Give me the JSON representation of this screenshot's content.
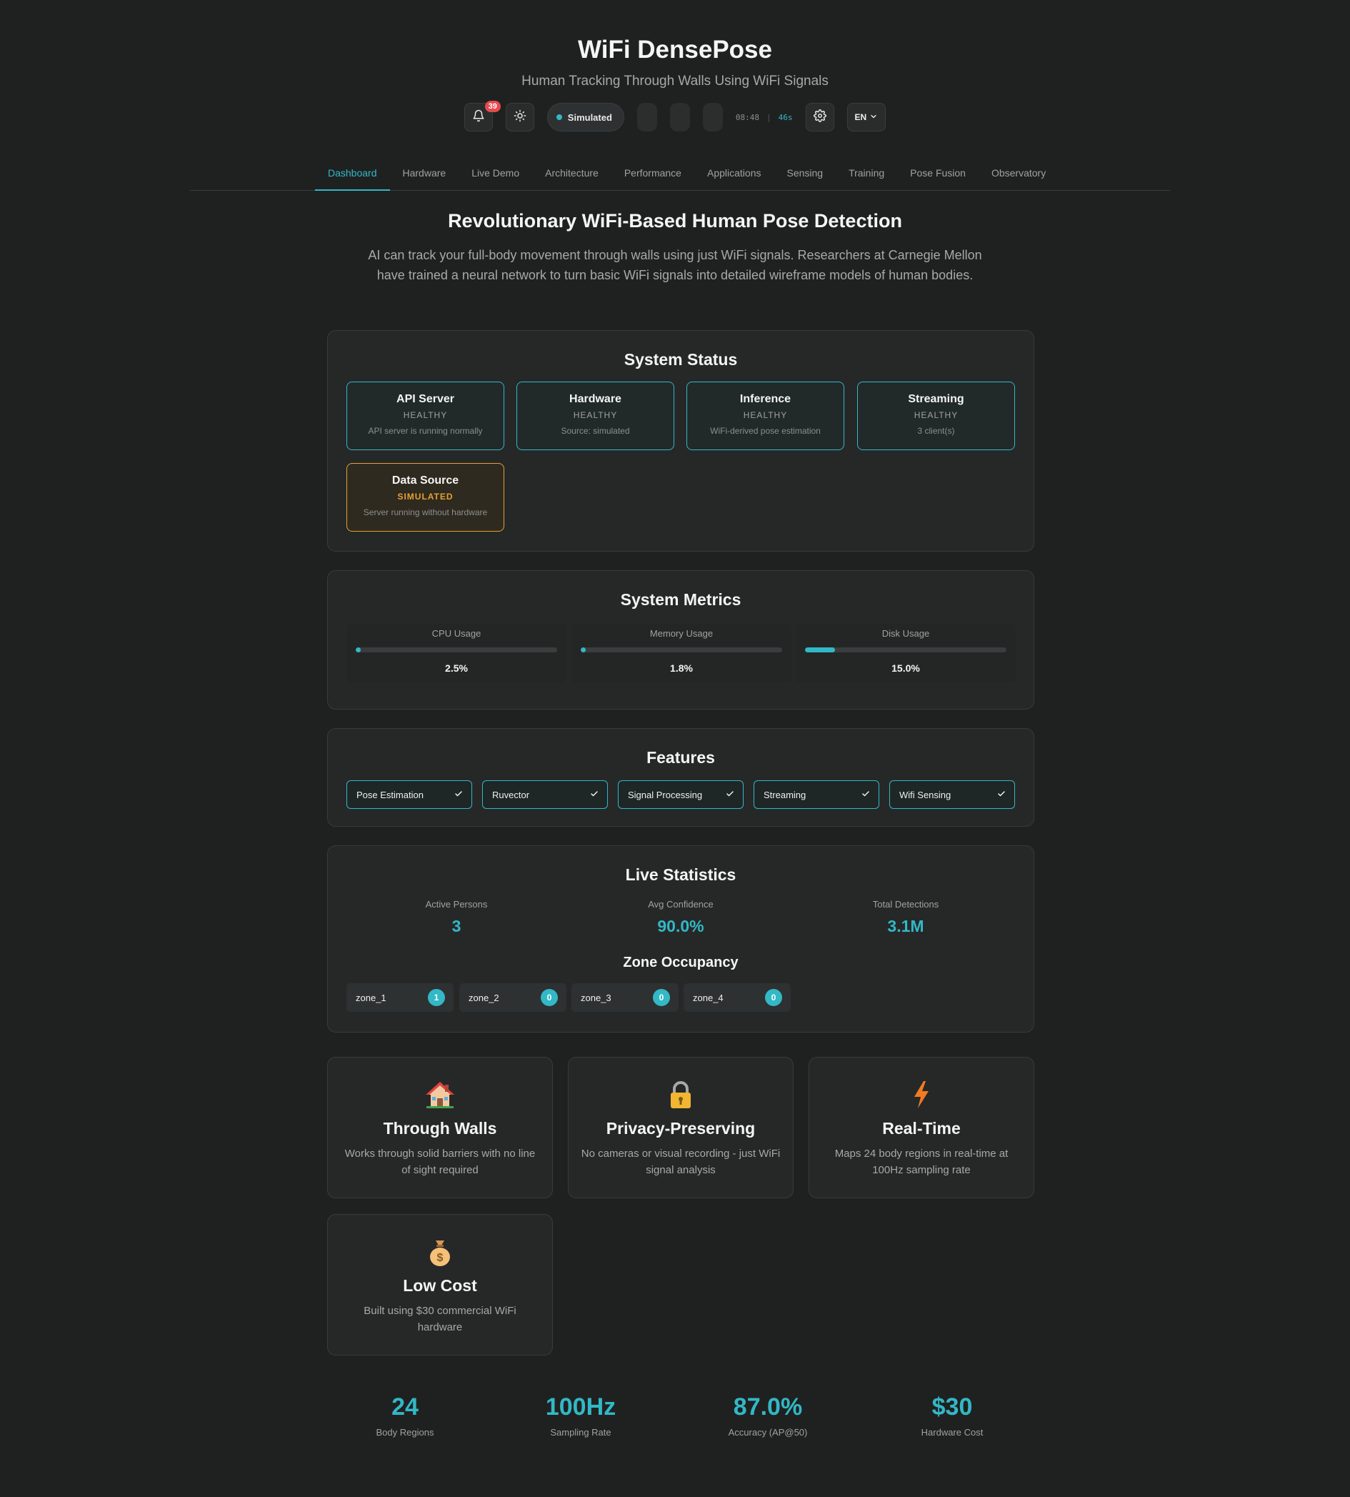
{
  "header": {
    "title": "WiFi DensePose",
    "subtitle": "Human Tracking Through Walls Using WiFi Signals",
    "notification_count": "39",
    "mode_label": "Simulated",
    "clock_time": "08:48",
    "clock_seconds": "46s",
    "language": "EN",
    "icons": [
      "bell-icon",
      "sun-icon",
      "gear-icon",
      "chevron-down-icon"
    ]
  },
  "nav": {
    "tabs": [
      {
        "label": "Dashboard",
        "active": true
      },
      {
        "label": "Hardware"
      },
      {
        "label": "Live Demo"
      },
      {
        "label": "Architecture"
      },
      {
        "label": "Performance"
      },
      {
        "label": "Applications"
      },
      {
        "label": "Sensing"
      },
      {
        "label": "Training"
      },
      {
        "label": "Pose Fusion"
      },
      {
        "label": "Observatory"
      }
    ]
  },
  "hero": {
    "title": "Revolutionary WiFi-Based Human Pose Detection",
    "text": "AI can track your full-body movement through walls using just WiFi signals. Researchers at Carnegie Mellon have trained a neural network to turn basic WiFi signals into detailed wireframe models of human bodies."
  },
  "system_status": {
    "title": "System Status",
    "items": [
      {
        "name": "API Server",
        "state": "HEALTHY",
        "desc": "API server is running normally"
      },
      {
        "name": "Hardware",
        "state": "HEALTHY",
        "desc": "Source: simulated"
      },
      {
        "name": "Inference",
        "state": "HEALTHY",
        "desc": "WiFi-derived pose estimation"
      },
      {
        "name": "Streaming",
        "state": "HEALTHY",
        "desc": "3 client(s)"
      },
      {
        "name": "Data Source",
        "state": "SIMULATED",
        "desc": "Server running without hardware"
      }
    ]
  },
  "system_metrics": {
    "title": "System Metrics",
    "items": [
      {
        "label": "CPU Usage",
        "value": "2.5%",
        "fraction": 0.025
      },
      {
        "label": "Memory Usage",
        "value": "1.8%",
        "fraction": 0.018
      },
      {
        "label": "Disk Usage",
        "value": "15.0%",
        "fraction": 0.15
      }
    ]
  },
  "features": {
    "title": "Features",
    "items": [
      "Pose Estimation",
      "Ruvector",
      "Signal Processing",
      "Streaming",
      "Wifi Sensing"
    ]
  },
  "live_statistics": {
    "title": "Live Statistics",
    "stats": [
      {
        "label": "Active Persons",
        "value": "3"
      },
      {
        "label": "Avg Confidence",
        "value": "90.0%"
      },
      {
        "label": "Total Detections",
        "value": "3.1M"
      }
    ],
    "zone_title": "Zone Occupancy",
    "zones": [
      {
        "name": "zone_1",
        "count": "1"
      },
      {
        "name": "zone_2",
        "count": "0"
      },
      {
        "name": "zone_3",
        "count": "0"
      },
      {
        "name": "zone_4",
        "count": "0"
      }
    ]
  },
  "tiles": [
    {
      "icon": "house-icon",
      "title": "Through Walls",
      "desc": "Works through solid barriers with no line of sight required"
    },
    {
      "icon": "lock-icon",
      "title": "Privacy-Preserving",
      "desc": "No cameras or visual recording - just WiFi signal analysis"
    },
    {
      "icon": "lightning-icon",
      "title": "Real-Time",
      "desc": "Maps 24 body regions in real-time at 100Hz sampling rate"
    },
    {
      "icon": "money-bag-icon",
      "title": "Low Cost",
      "desc": "Built using $30 commercial WiFi hardware"
    }
  ],
  "bottom_stats": [
    {
      "value": "24",
      "label": "Body Regions"
    },
    {
      "value": "100Hz",
      "label": "Sampling Rate"
    },
    {
      "value": "87.0%",
      "label": "Accuracy (AP@50)"
    },
    {
      "value": "$30",
      "label": "Hardware Cost"
    }
  ],
  "colors": {
    "background": "#1f2121",
    "accent": "#32b8c6",
    "warning": "#e6a032",
    "badge": "#e64a4f"
  }
}
